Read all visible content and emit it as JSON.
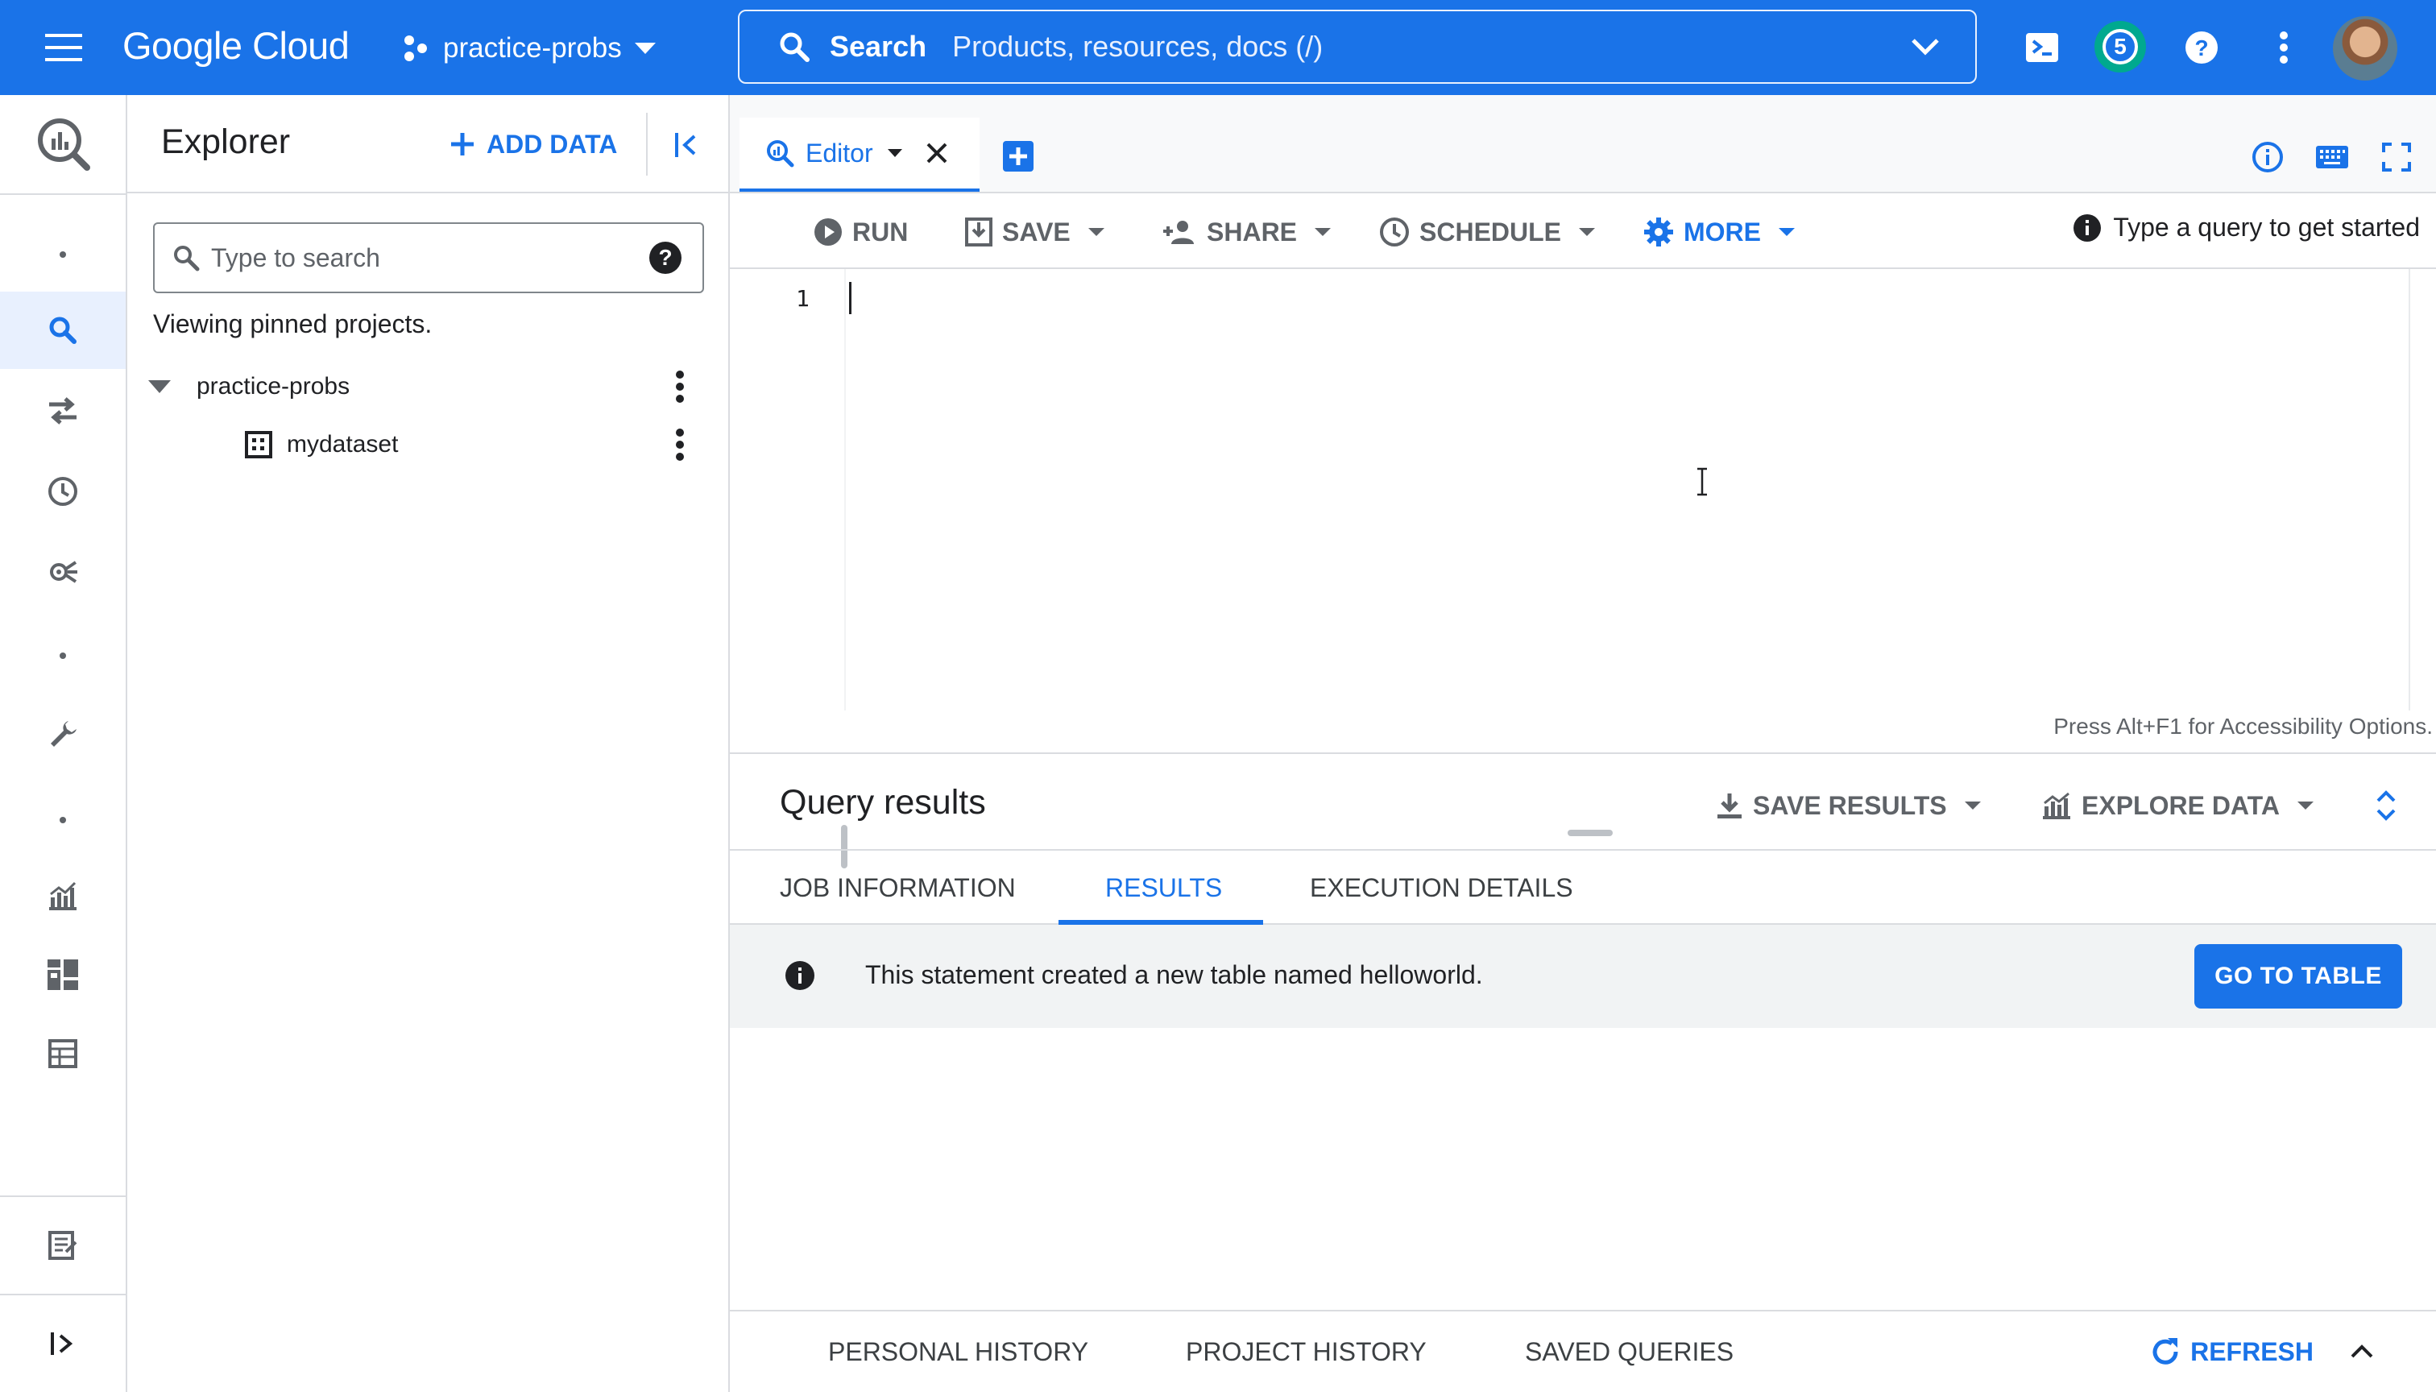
{
  "topbar": {
    "logo_text": "Google Cloud",
    "project_name": "practice-probs",
    "search_label": "Search",
    "search_placeholder": "Products, resources, docs (/)",
    "notification_count": "5",
    "icons": [
      "menu-icon",
      "project-icon",
      "dropdown-icon",
      "search-icon",
      "chevron-down-icon",
      "cloud-shell-icon",
      "help-icon",
      "more-vert-icon",
      "avatar"
    ]
  },
  "rail": {
    "items": [
      "bigquery-logo-icon",
      "search-icon",
      "transfer-icon",
      "history-icon",
      "analytics-hub-icon",
      "wrench-icon",
      "chart-icon",
      "dashboard-icon",
      "table-icon",
      "release-notes-icon",
      "expand-icon"
    ],
    "active": "search-icon"
  },
  "explorer": {
    "title": "Explorer",
    "add_data_label": "ADD DATA",
    "search_placeholder": "Type to search",
    "help_glyph": "?",
    "viewing_note": "Viewing pinned projects.",
    "tree": [
      {
        "label": "practice-probs",
        "type": "project",
        "expanded": true
      },
      {
        "label": "mydataset",
        "type": "dataset"
      }
    ]
  },
  "tabs": {
    "editor_label": "Editor",
    "icons": [
      "info-icon",
      "keyboard-icon",
      "fullscreen-icon"
    ]
  },
  "toolbar": {
    "run_label": "RUN",
    "save_label": "SAVE",
    "share_label": "SHARE",
    "schedule_label": "SCHEDULE",
    "more_label": "MORE",
    "hint_text": "Type a query to get started"
  },
  "editor": {
    "line_number": "1",
    "content": "",
    "accessibility_note": "Press Alt+F1 for Accessibility Options."
  },
  "results": {
    "title": "Query results",
    "save_results_label": "SAVE RESULTS",
    "explore_data_label": "EXPLORE DATA",
    "tabs": [
      "JOB INFORMATION",
      "RESULTS",
      "EXECUTION DETAILS"
    ],
    "active_tab": "RESULTS",
    "info_message": "This statement created a new table named helloworld.",
    "go_to_table_label": "GO TO TABLE"
  },
  "history": {
    "tabs": [
      "PERSONAL HISTORY",
      "PROJECT HISTORY",
      "SAVED QUERIES"
    ],
    "refresh_label": "REFRESH"
  },
  "colors": {
    "brand_blue": "#1a73e8",
    "notification_ring": "#00a98f",
    "text": "#202124",
    "muted": "#5f6368"
  }
}
